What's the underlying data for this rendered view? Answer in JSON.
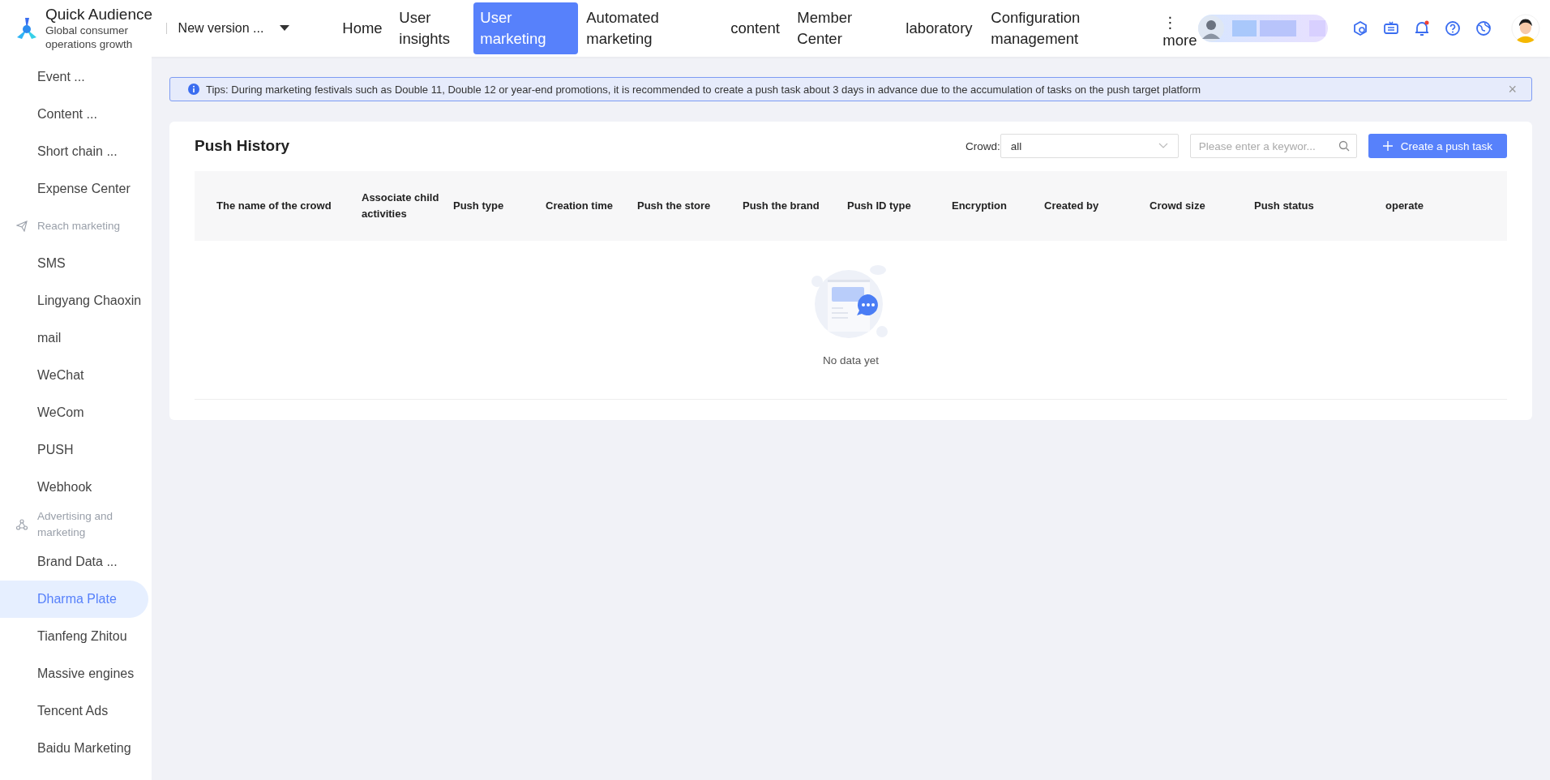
{
  "brand": {
    "title": "Quick Audience",
    "subtitle": "Global consumer operations growth"
  },
  "version_select": {
    "value": "New version ..."
  },
  "nav": [
    {
      "label": "Home",
      "selected": false
    },
    {
      "label": "User insights",
      "selected": false
    },
    {
      "label": "User marketing",
      "selected": true
    },
    {
      "label": "Automated marketing",
      "selected": false
    },
    {
      "label": "content",
      "selected": false
    },
    {
      "label": "Member Center",
      "selected": false
    },
    {
      "label": "laboratory",
      "selected": false
    },
    {
      "label": "Configuration management",
      "selected": false
    }
  ],
  "more": {
    "glyph": "⋮",
    "label": "more"
  },
  "notifications": {
    "unread": true
  },
  "sidebar": {
    "items": [
      {
        "kind": "item",
        "label": "Event ...",
        "selected": false
      },
      {
        "kind": "item",
        "label": "Content ...",
        "selected": false
      },
      {
        "kind": "item",
        "label": "Short chain ...",
        "selected": false
      },
      {
        "kind": "item",
        "label": "Expense Center",
        "selected": false
      },
      {
        "kind": "group",
        "label": "Reach marketing"
      },
      {
        "kind": "item",
        "label": "SMS",
        "selected": false
      },
      {
        "kind": "item",
        "label": "Lingyang Chaoxin",
        "selected": false
      },
      {
        "kind": "item",
        "label": "mail",
        "selected": false
      },
      {
        "kind": "item",
        "label": "WeChat",
        "selected": false
      },
      {
        "kind": "item",
        "label": "WeCom",
        "selected": false
      },
      {
        "kind": "item",
        "label": "PUSH",
        "selected": false
      },
      {
        "kind": "item",
        "label": "Webhook",
        "selected": false
      },
      {
        "kind": "group",
        "label": "Advertising and marketing"
      },
      {
        "kind": "item",
        "label": "Brand Data ...",
        "selected": false
      },
      {
        "kind": "item",
        "label": "Dharma Plate",
        "selected": true
      },
      {
        "kind": "item",
        "label": "Tianfeng Zhitou",
        "selected": false
      },
      {
        "kind": "item",
        "label": "Massive engines",
        "selected": false
      },
      {
        "kind": "item",
        "label": "Tencent Ads",
        "selected": false
      },
      {
        "kind": "item",
        "label": "Baidu Marketing",
        "selected": false
      }
    ]
  },
  "tip": {
    "text": "Tips: During marketing festivals such as Double 11, Double 12 or year-end promotions, it is recommended to create a push task about 3 days in advance due to the accumulation of tasks on the push target platform",
    "close": "×"
  },
  "panel": {
    "title": "Push History",
    "crowd_label": "Crowd:",
    "crowd_value": "all",
    "search": {
      "placeholder": "Please enter a keywor..."
    },
    "create_button": "Create a push task"
  },
  "table": {
    "columns": [
      "The name of the crowd",
      "Associate child activities",
      "Push type",
      "Creation time",
      "Push the store",
      "Push the brand",
      "Push ID type",
      "Encryption",
      "Created by",
      "Crowd size",
      "Push status",
      "operate"
    ],
    "empty_text": "No data yet"
  }
}
